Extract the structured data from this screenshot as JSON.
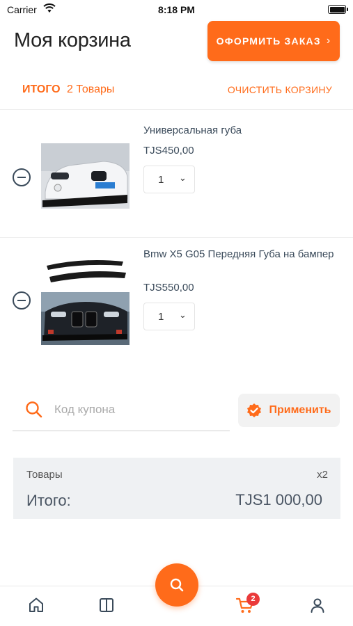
{
  "status_bar": {
    "carrier": "Carrier",
    "time": "8:18 PM"
  },
  "header": {
    "title": "Моя корзина",
    "checkout_label": "ОФОРМИТЬ ЗАКАЗ"
  },
  "summary": {
    "total_label": "ИТОГО",
    "item_count": "2 Товары",
    "clear_label": "ОЧИСТИТЬ КОРЗИНУ"
  },
  "cart_items": [
    {
      "name": "Универсальная губа",
      "price": "TJS450,00",
      "quantity": "1"
    },
    {
      "name": "Bmw X5 G05  Передняя Губа на бампер",
      "price": "TJS550,00",
      "quantity": "1"
    }
  ],
  "coupon": {
    "placeholder": "Код купона",
    "apply_label": "Применить"
  },
  "totals": {
    "goods_label": "Товары",
    "goods_count": "x2",
    "grand_label": "Итого:",
    "grand_value": "TJS1 000,00"
  },
  "tab_bar": {
    "cart_badge": "2"
  },
  "colors": {
    "accent": "#ff6b1a",
    "badge": "#ea3a3a",
    "text_dark": "#3a4a5a",
    "totals_bg": "#eff1f3"
  },
  "icons": [
    "wifi-icon",
    "battery-icon",
    "chevron-right-icon",
    "minus-circle-icon",
    "chevron-down-icon",
    "search-icon",
    "verified-badge-icon",
    "home-icon",
    "categories-icon",
    "cart-icon",
    "user-icon"
  ]
}
